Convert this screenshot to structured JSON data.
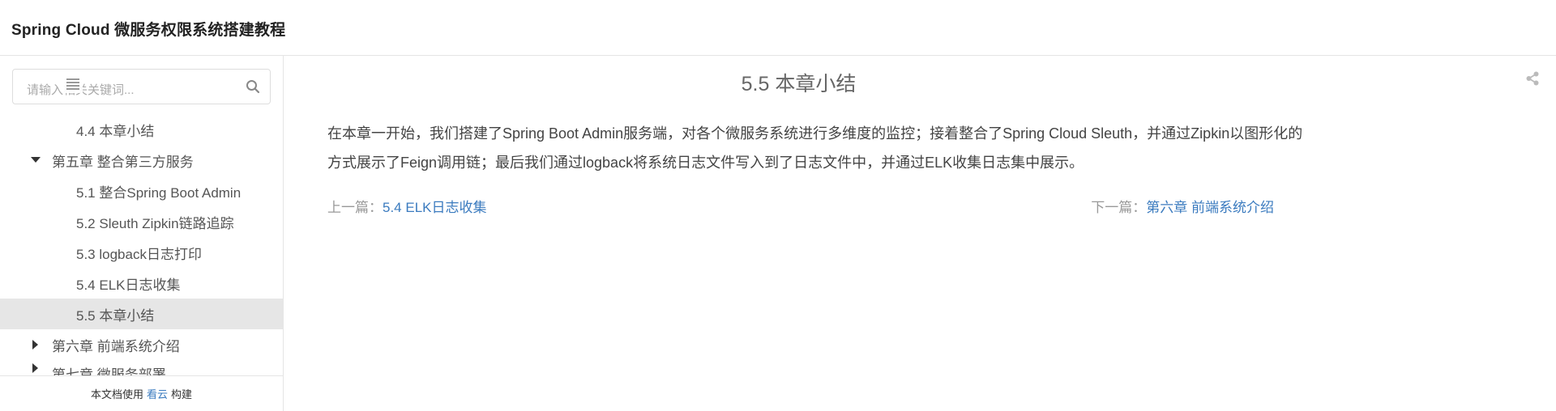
{
  "header": {
    "title": "Spring Cloud 微服务权限系统搭建教程"
  },
  "search": {
    "placeholder": "请输入相关关键词..."
  },
  "toc": [
    {
      "label": "4.4 本章小结",
      "level": 2
    },
    {
      "label": "第五章 整合第三方服务",
      "level": 1,
      "expanded": true
    },
    {
      "label": "5.1 整合Spring Boot Admin",
      "level": 2
    },
    {
      "label": "5.2 Sleuth Zipkin链路追踪",
      "level": 2
    },
    {
      "label": "5.3 logback日志打印",
      "level": 2
    },
    {
      "label": "5.4 ELK日志收集",
      "level": 2
    },
    {
      "label": "5.5 本章小结",
      "level": 2,
      "active": true
    },
    {
      "label": "第六章 前端系统介绍",
      "level": 1,
      "expanded": false
    },
    {
      "label": "第七章 微服务部署",
      "level": 1,
      "expanded": false
    }
  ],
  "footer": {
    "prefix": "本文档使用",
    "link": "看云",
    "suffix": "构建"
  },
  "main": {
    "heading": "5.5 本章小结",
    "paragraph": "在本章一开始，我们搭建了Spring Boot Admin服务端，对各个微服务系统进行多维度的监控；接着整合了Spring Cloud Sleuth，并通过Zipkin以图形化的方式展示了Feign调用链；最后我们通过logback将系统日志文件写入到了日志文件中，并通过ELK收集日志集中展示。",
    "prev_label": "上一篇：",
    "prev_link": "5.4 ELK日志收集",
    "next_label": "下一篇：",
    "next_link": "第六章 前端系统介绍"
  },
  "colors": {
    "link": "#3b7bbf",
    "active_bg": "#e6e6e6",
    "border": "#e5e5e5"
  },
  "icons": {
    "menu": "menu-icon",
    "search": "search-icon",
    "share": "share-icon",
    "caret_down": "caret-down-icon",
    "caret_right": "caret-right-icon"
  }
}
